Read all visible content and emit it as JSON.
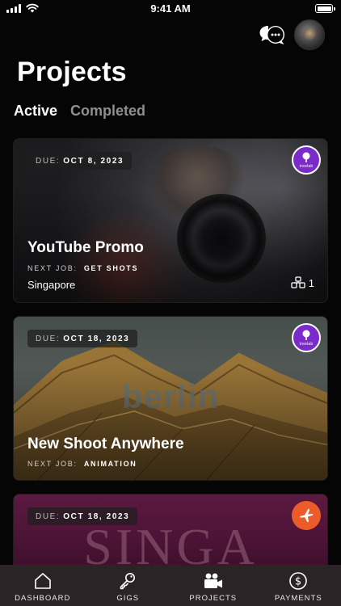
{
  "status_bar": {
    "time": "9:41 AM"
  },
  "header": {
    "title": "Projects"
  },
  "tabs": [
    {
      "label": "Active",
      "active": true
    },
    {
      "label": "Completed",
      "active": false
    }
  ],
  "projects": [
    {
      "due_label": "DUE:",
      "due_date": "OCT 8, 2023",
      "title": "YouTube Promo",
      "next_job_label": "NEXT JOB:",
      "next_job": "GET SHOTS",
      "location": "Singapore",
      "crew_count": "1",
      "logo_icon": "treelab-logo",
      "logo_text": "treelab"
    },
    {
      "due_label": "DUE:",
      "due_date": "OCT 18, 2023",
      "title": "New Shoot Anywhere",
      "next_job_label": "NEXT JOB:",
      "next_job": "ANIMATION",
      "background_text": "berlin",
      "logo_icon": "treelab-logo",
      "logo_text": "treelab"
    },
    {
      "due_label": "DUE:",
      "due_date": "OCT 18, 2023",
      "background_text": "SINGA",
      "logo_icon": "airplane-icon"
    }
  ],
  "nav": [
    {
      "label": "DASHBOARD",
      "icon": "home-icon"
    },
    {
      "label": "GIGS",
      "icon": "key-icon"
    },
    {
      "label": "PROJECTS",
      "icon": "video-camera-icon",
      "active": true
    },
    {
      "label": "PAYMENTS",
      "icon": "dollar-icon"
    }
  ],
  "colors": {
    "background": "#050505",
    "logo_purple": "#7b2bc9",
    "logo_orange": "#ec5b2a",
    "tab_bar": "#2b2426",
    "inactive_tab": "#8f8f8f"
  }
}
